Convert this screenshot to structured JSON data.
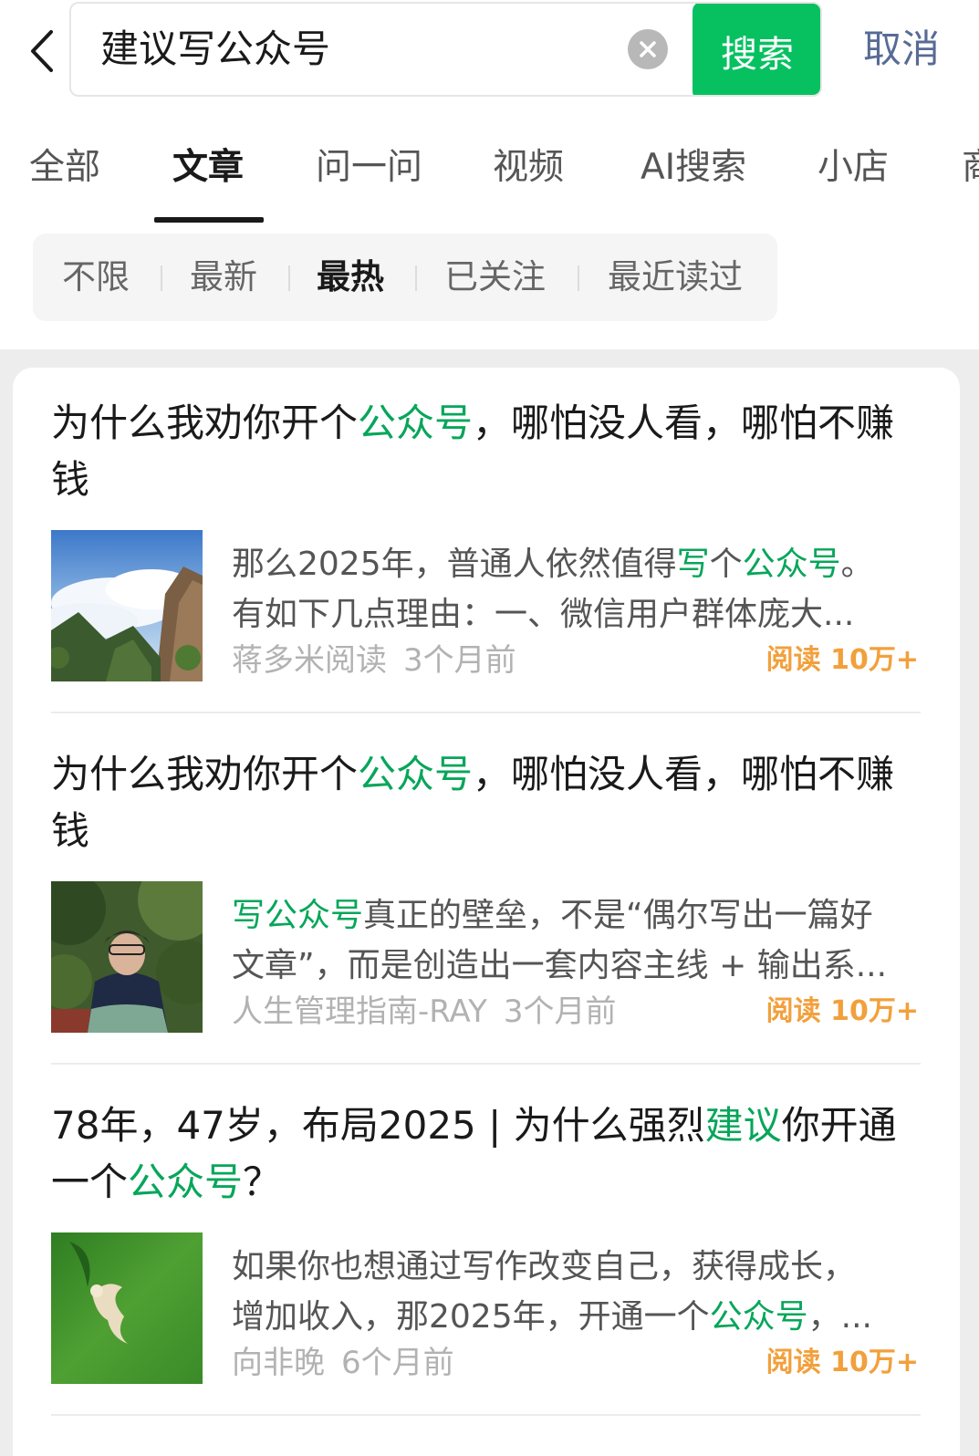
{
  "search": {
    "query": "建议写公众号",
    "search_label": "搜索",
    "cancel_label": "取消"
  },
  "tabs": [
    {
      "label": "全部"
    },
    {
      "label": "文章",
      "active": true
    },
    {
      "label": "问一问"
    },
    {
      "label": "视频"
    },
    {
      "label": "AI搜索"
    },
    {
      "label": "小店"
    },
    {
      "label": "商"
    }
  ],
  "filters": [
    {
      "label": "不限"
    },
    {
      "label": "最新"
    },
    {
      "label": "最热",
      "active": true
    },
    {
      "label": "已关注"
    },
    {
      "label": "最近读过"
    }
  ],
  "colors": {
    "accent": "#07c160",
    "highlight": "#07a65a",
    "cancel": "#576b95",
    "reads": "#f2a03c"
  },
  "results": [
    {
      "title": [
        {
          "t": "为什么我劝你开个"
        },
        {
          "t": "公众号",
          "hl": true
        },
        {
          "t": "，哪怕没人看，哪怕不赚钱"
        }
      ],
      "thumb": "mountain-clouds-image",
      "snippet_line1": [
        {
          "t": "那么2025年，普通人依然值得"
        },
        {
          "t": "写",
          "hl": true
        },
        {
          "t": "个"
        },
        {
          "t": "公众号",
          "hl": true
        },
        {
          "t": "。"
        }
      ],
      "snippet_line2": [
        {
          "t": "有如下几点理由：一、微信用户群体庞大..."
        }
      ],
      "source": "蒋多米阅读",
      "time": "3个月前",
      "reads": "阅读 10万+"
    },
    {
      "title": [
        {
          "t": "为什么我劝你开个"
        },
        {
          "t": "公众号",
          "hl": true
        },
        {
          "t": "，哪怕没人看，哪怕不赚钱"
        }
      ],
      "thumb": "person-portrait-image",
      "snippet_line1": [
        {
          "t": "写公众号",
          "hl": true
        },
        {
          "t": "真正的壁垒，不是“偶尔写出一篇好"
        }
      ],
      "snippet_line2": [
        {
          "t": "文章”，而是创造出一套内容主线 + 输出系..."
        }
      ],
      "source": "人生管理指南-RAY",
      "time": "3个月前",
      "reads": "阅读 10万+"
    },
    {
      "title": [
        {
          "t": "78年，47岁，布局2025 | 为什么强烈"
        },
        {
          "t": "建议",
          "hl": true
        },
        {
          "t": "你开通一个"
        },
        {
          "t": "公众号",
          "hl": true
        },
        {
          "t": "？"
        }
      ],
      "thumb": "grass-figure-image",
      "snippet_line1": [
        {
          "t": "如果你也想通过写作改变自己，获得成长，"
        }
      ],
      "snippet_line2": [
        {
          "t": "增加收入，那2025年，开通一个"
        },
        {
          "t": "公众号",
          "hl": true
        },
        {
          "t": "，..."
        }
      ],
      "source": "向非晚",
      "time": "6个月前",
      "reads": "阅读 10万+"
    }
  ]
}
